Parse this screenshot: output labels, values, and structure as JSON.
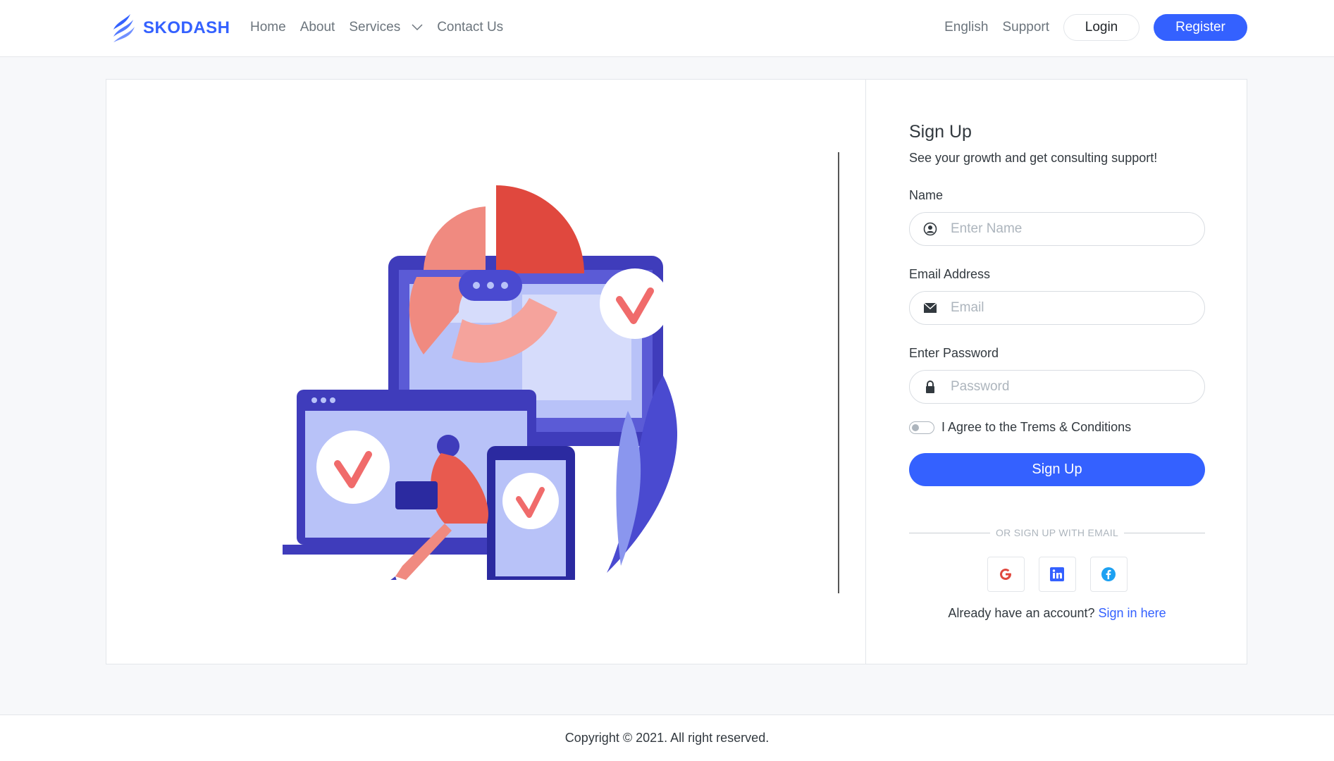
{
  "header": {
    "brand": "SKODASH",
    "nav": {
      "home": "Home",
      "about": "About",
      "services": "Services",
      "contact": "Contact Us"
    },
    "right": {
      "language": "English",
      "support": "Support",
      "login": "Login",
      "register": "Register"
    }
  },
  "signup": {
    "title": "Sign Up",
    "subtitle": "See your growth and get consulting support!",
    "name_label": "Name",
    "name_placeholder": "Enter Name",
    "email_label": "Email Address",
    "email_placeholder": "Email",
    "password_label": "Enter Password",
    "password_placeholder": "Password",
    "agree_text": "I Agree to the Trems & Conditions",
    "submit_label": "Sign Up",
    "divider_text": "OR SIGN UP WITH EMAIL",
    "already_text": "Already have an account? ",
    "signin_link": "Sign in here"
  },
  "social": [
    "google-icon",
    "linkedin-icon",
    "facebook-icon"
  ],
  "footer": {
    "copyright": "Copyright © 2021. All right reserved."
  },
  "colors": {
    "primary": "#3461ff",
    "illustration_red": "#e85a4f",
    "illustration_indigo": "#3f3cbb"
  }
}
